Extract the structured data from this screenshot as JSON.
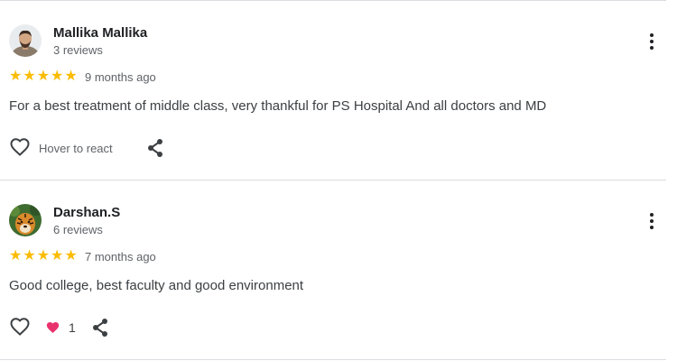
{
  "reviews": [
    {
      "name": "Mallika Mallika",
      "review_count": "3 reviews",
      "rating": 5,
      "time_ago": "9 months ago",
      "text": "For a best treatment of middle class, very thankful for PS Hospital And all doctors and MD",
      "react_label": "Hover to react",
      "avatar_icon": "person-photo-icon"
    },
    {
      "name": "Darshan.S",
      "review_count": "6 reviews",
      "rating": 5,
      "time_ago": "7 months ago",
      "text": "Good college, best faculty and good environment",
      "reaction_count": "1",
      "reaction_color": "#e8336e",
      "avatar_icon": "tiger-photo-icon"
    }
  ],
  "colors": {
    "star": "#fbbc04",
    "divider": "#dadce0",
    "secondary_text": "#5f6368",
    "icon": "#5f6368"
  }
}
